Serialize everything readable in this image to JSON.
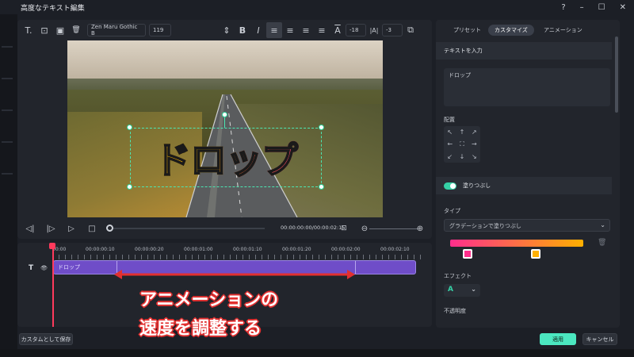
{
  "window": {
    "title": "高度なテキスト編集",
    "help_icon": "?",
    "minimize_icon": "–",
    "maximize_icon": "☐",
    "close_icon": "✕"
  },
  "toolbar": {
    "text_icon": "T.",
    "text_box_icon": "⊡",
    "image_icon": "▣",
    "delete_icon": "🗑",
    "font_family": "Zen Maru Gothic B",
    "font_size": "119",
    "spacing_icon": "⇕",
    "bold": "B",
    "italic": "I",
    "align_left": "≡",
    "align_center": "≡",
    "align_right": "≡",
    "justify": "≡",
    "char_spacing_icon": "A",
    "char_spacing_value": "-18",
    "line_spacing_icon": "|A|",
    "line_spacing_value": "-3",
    "layer_icon": "⧉"
  },
  "preview": {
    "title_text": "ドロップ"
  },
  "playback": {
    "prev_frame": "◁|",
    "next_frame": "|▷",
    "play": "▷",
    "stop": "□",
    "timecode": "00:00:00:00/00:00:02:15",
    "fit_icon": "⊡",
    "zoom_out": "⊖",
    "zoom_in": "⊕"
  },
  "timeline": {
    "ruler": [
      "00:00",
      "00:00:00:10",
      "00:00:00:20",
      "00:00:01:00",
      "00:00:01:10",
      "00:00:01:20",
      "00:00:02:00",
      "00:00:02:10"
    ],
    "track_type_icon": "T",
    "visibility_icon": "👁",
    "clip_label": "ドロップ"
  },
  "annotation": {
    "line1": "アニメーションの",
    "line2": "速度を調整する"
  },
  "right_panel": {
    "tabs": [
      "プリセット",
      "カスタマイズ",
      "アニメーション"
    ],
    "active_tab": "カスタマイズ",
    "text_input_header": "テキストを入力",
    "text_value": "ドロップ",
    "alignment_label": "配置",
    "alignment_grid": [
      "↖",
      "↑",
      "↗",
      "←",
      "⛶",
      "→",
      "↙",
      "↓",
      "↘"
    ],
    "fill_toggle_label": "塗りつぶし",
    "fill_enabled": true,
    "type_label": "タイプ",
    "type_value": "グラデーションで塗りつぶし",
    "gradient_start_color": "#ff2e8c",
    "gradient_end_color": "#ffb000",
    "effect_label": "エフェクト",
    "effect_value": "A",
    "opacity_label": "不透明度"
  },
  "footer": {
    "save_custom": "カスタムとして保存",
    "apply": "適用",
    "cancel": "キャンセル"
  }
}
